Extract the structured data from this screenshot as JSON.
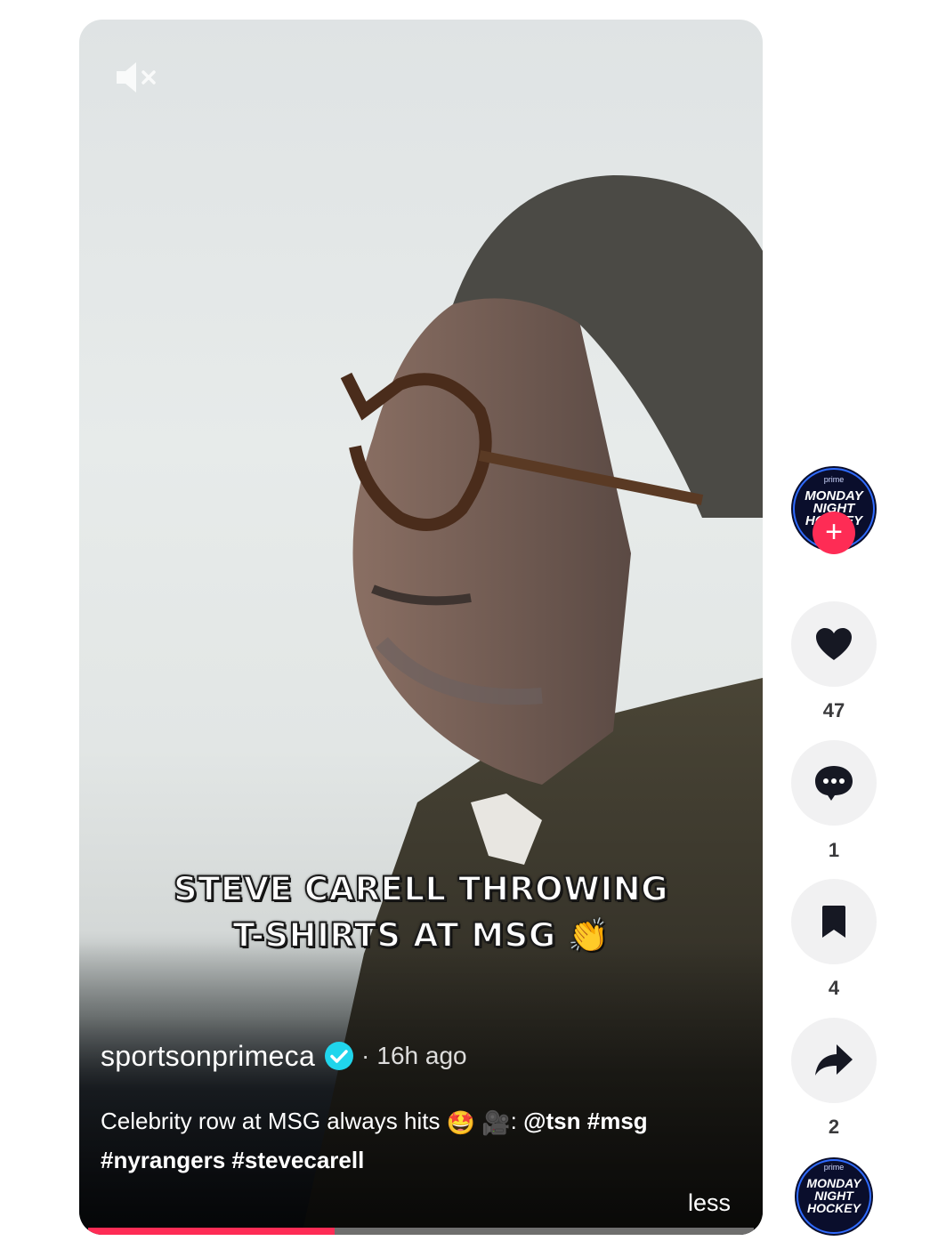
{
  "video": {
    "caption_lines": [
      "STEVE CARELL THROWING",
      "T-SHIRTS AT MSG"
    ],
    "caption_emoji": "👏",
    "author": "sportsonprimeca",
    "verified": true,
    "separator": "·",
    "posted": "16h ago",
    "description_text": "Celebrity row at MSG always hits",
    "description_emoji_1": "🤩",
    "description_emoji_2": "🎥",
    "description_colon": ":",
    "mention": "@tsn",
    "hashtags": [
      "#msg",
      "#nyrangers",
      "#stevecarell"
    ],
    "less_label": "less",
    "progress": 0.37
  },
  "profile": {
    "prime_label": "prime",
    "logo_lines": [
      "MONDAY",
      "NIGHT",
      "HOCKEY"
    ],
    "follow_symbol": "+"
  },
  "actions": {
    "likes": "47",
    "comments": "1",
    "saves": "4",
    "shares": "2"
  },
  "icons": [
    "mute-icon",
    "verified-badge-icon",
    "heart-icon",
    "comment-icon",
    "bookmark-icon",
    "share-icon",
    "plus-icon"
  ],
  "colors": {
    "accent": "#fe2c55",
    "verified": "#20d5ec",
    "action_bg": "#f1f1f2"
  }
}
